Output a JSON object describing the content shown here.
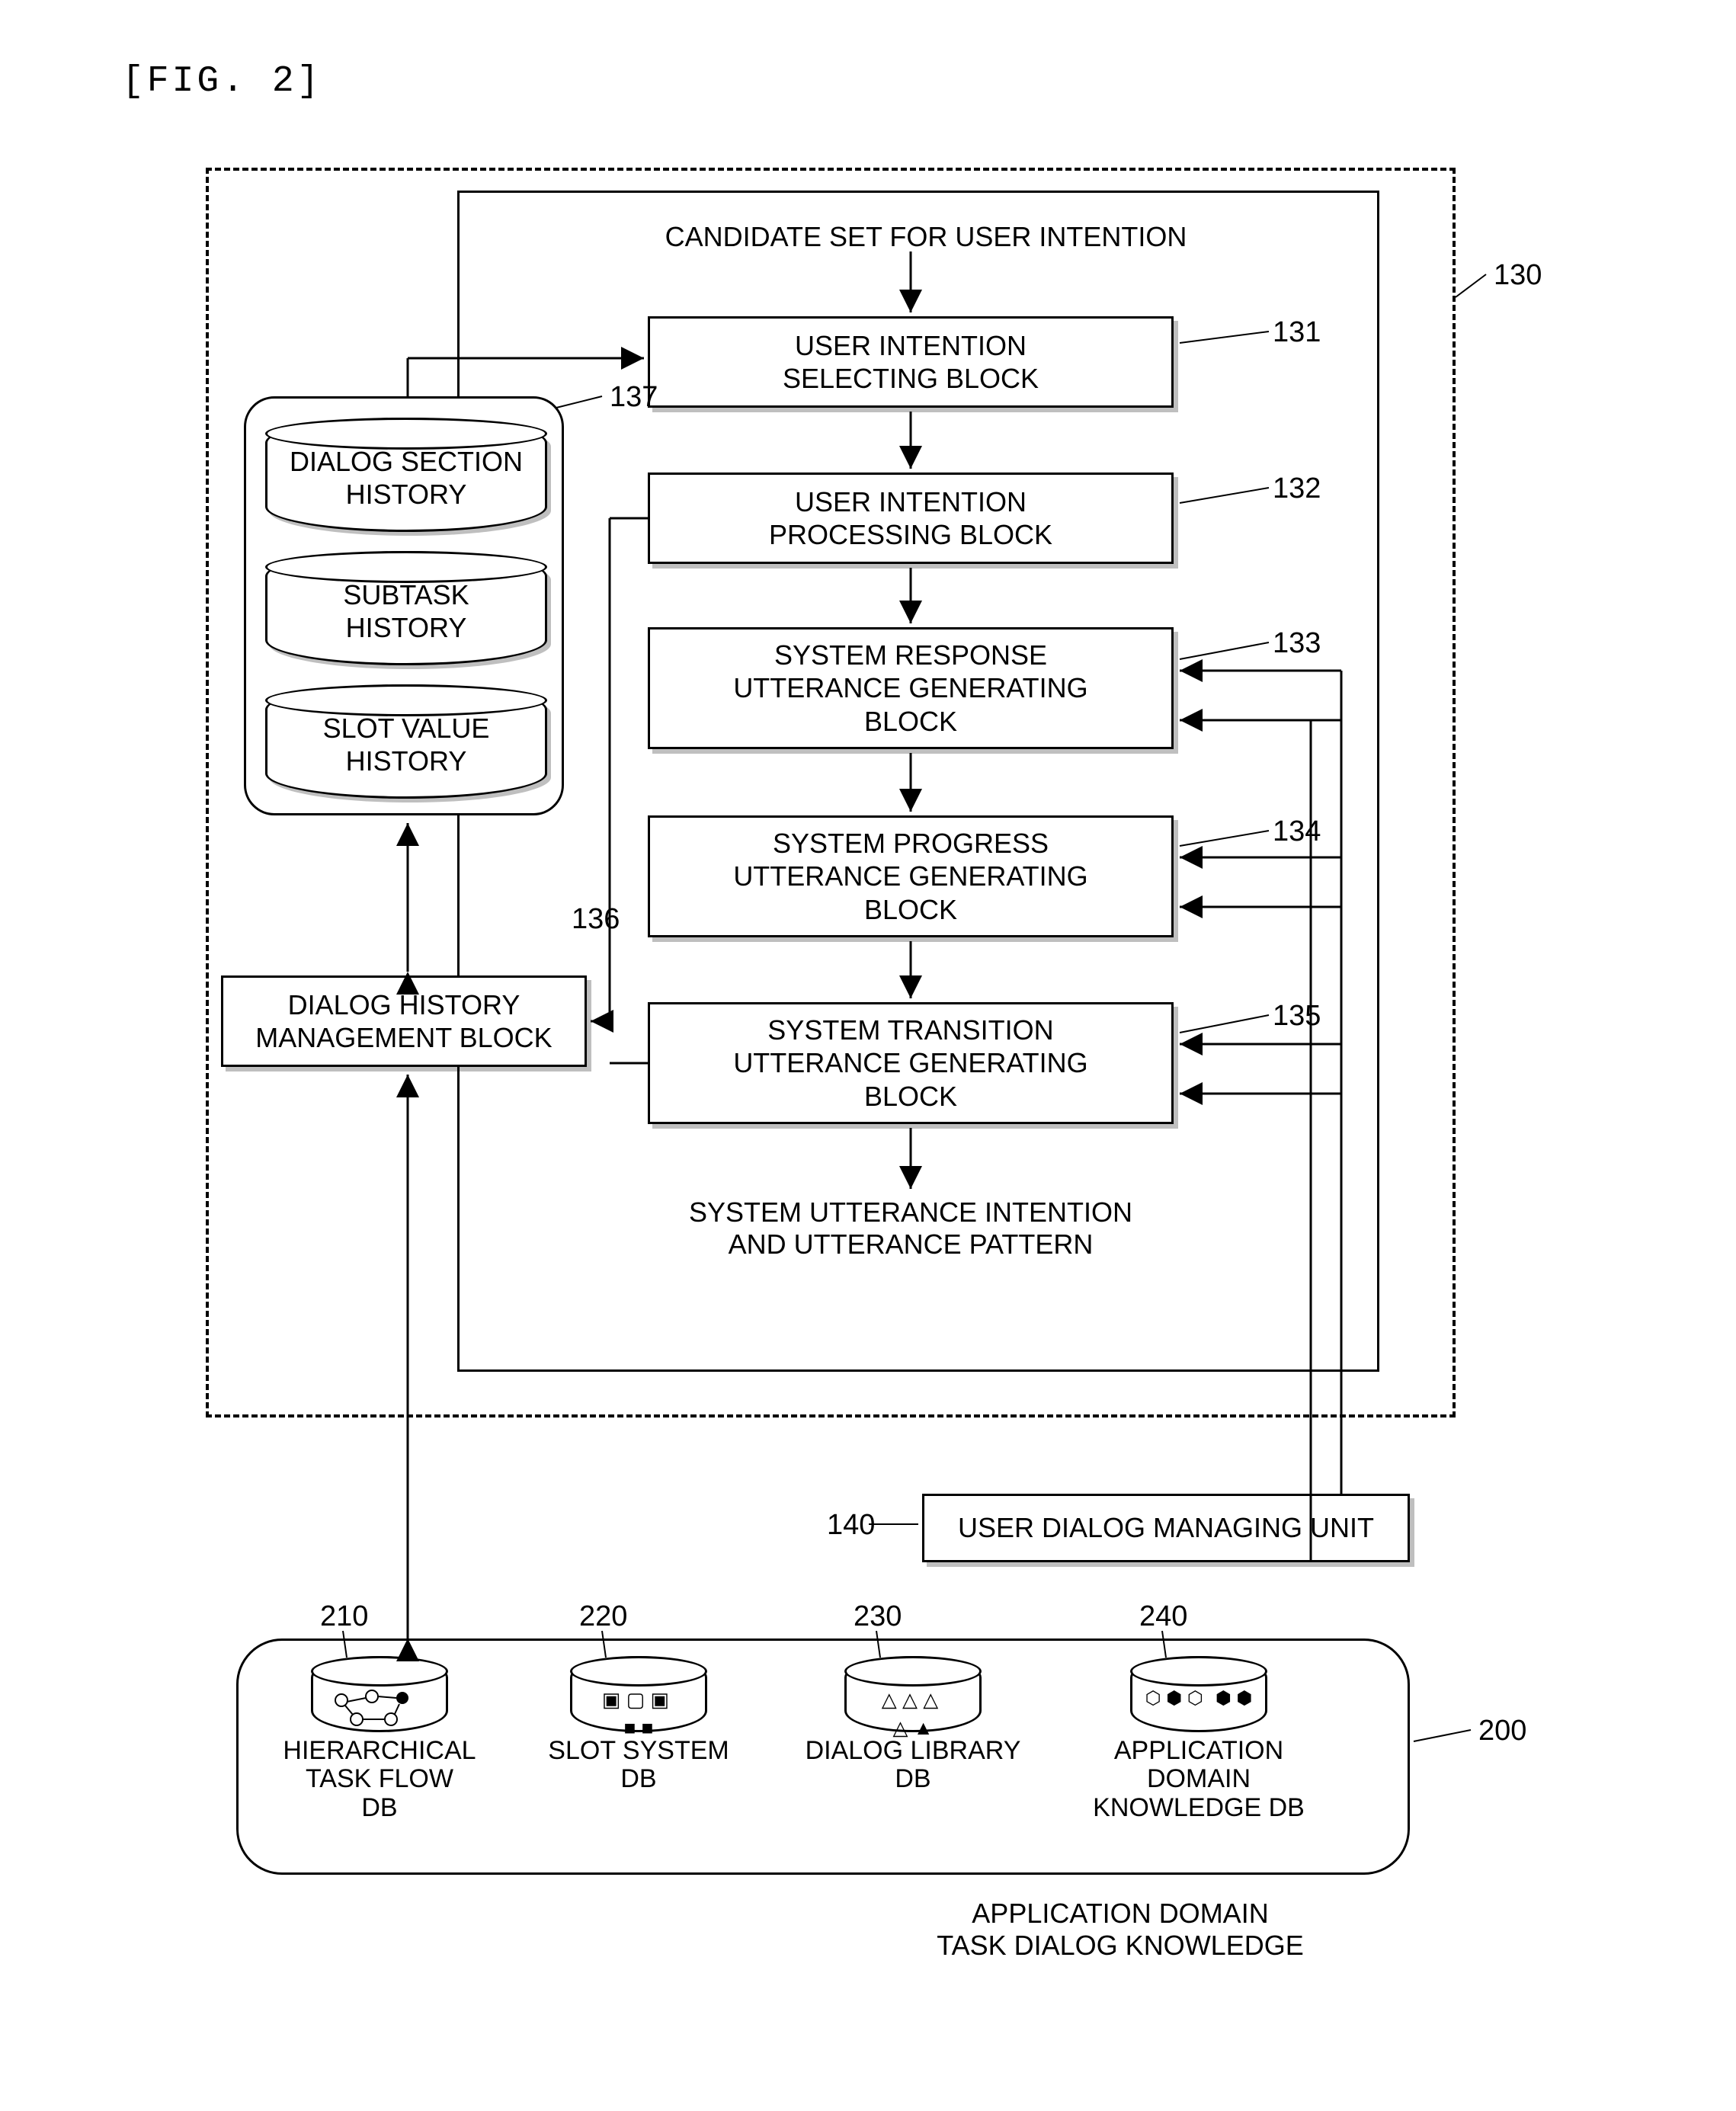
{
  "figure_label": "[FIG. 2]",
  "refs": {
    "r130": "130",
    "r131": "131",
    "r132": "132",
    "r133": "133",
    "r134": "134",
    "r135": "135",
    "r136": "136",
    "r137": "137",
    "r140": "140",
    "r200": "200",
    "r210": "210",
    "r220": "220",
    "r230": "230",
    "r240": "240"
  },
  "labels": {
    "candidate_set": "CANDIDATE SET FOR USER INTENTION",
    "user_intention_selecting": "USER INTENTION\nSELECTING BLOCK",
    "user_intention_processing": "USER INTENTION\nPROCESSING BLOCK",
    "system_response": "SYSTEM RESPONSE\nUTTERANCE GENERATING\nBLOCK",
    "system_progress": "SYSTEM PROGRESS\nUTTERANCE GENERATING\nBLOCK",
    "system_transition": "SYSTEM TRANSITION\nUTTERANCE GENERATING\nBLOCK",
    "system_utterance_out": "SYSTEM UTTERANCE INTENTION\nAND UTTERANCE PATTERN",
    "dialog_section_history": "DIALOG SECTION\nHISTORY",
    "subtask_history": "SUBTASK\nHISTORY",
    "slot_value_history": "SLOT VALUE\nHISTORY",
    "dialog_history_mgmt": "DIALOG HISTORY\nMANAGEMENT BLOCK",
    "user_dialog_managing": "USER DIALOG MANAGING UNIT",
    "hierarchical_task_flow_db": "HIERARCHICAL\nTASK FLOW\nDB",
    "slot_system_db": "SLOT SYSTEM\nDB",
    "dialog_library_db": "DIALOG LIBRARY\nDB",
    "application_domain_knowledge_db": "APPLICATION\nDOMAIN\nKNOWLEDGE DB",
    "application_domain_task": "APPLICATION DOMAIN\nTASK DIALOG KNOWLEDGE"
  }
}
